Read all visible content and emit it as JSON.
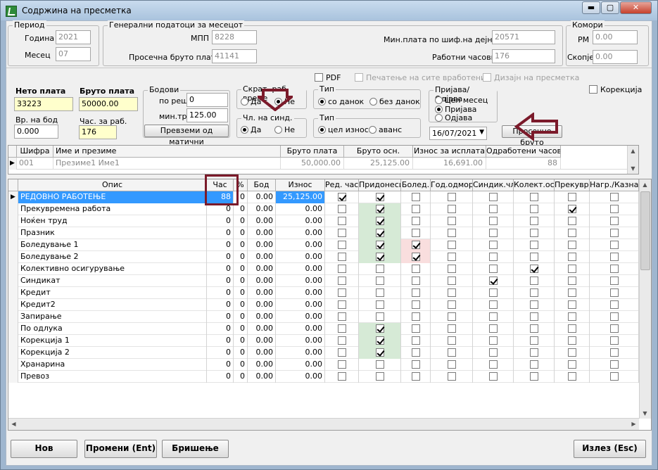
{
  "window": {
    "title": "Содржина на пресметка",
    "min": "▬",
    "max": "▢",
    "close": "✕"
  },
  "period": {
    "legend": "Период",
    "year_label": "Година",
    "year": "2021",
    "month_label": "Месец",
    "month": "07"
  },
  "general": {
    "legend": "Генерални податоци за месецот",
    "mpp_label": "МПП",
    "mpp": "8228",
    "avg_label": "Просечна бруто плата",
    "avg": "41141",
    "min_label": "Мин.плата по шиф.на дејност",
    "min": "20571",
    "hours_label": "Работни часови",
    "hours": "176"
  },
  "chambers": {
    "legend": "Комори",
    "rm_label": "РМ",
    "rm": "0.00",
    "sk_label": "Скопје",
    "sk": "0.00"
  },
  "options": {
    "pdf": "PDF",
    "print_all": "Печатење на сите вработени",
    "design": "Дизајн на пресметка",
    "correction": "Корекција"
  },
  "pay": {
    "net_label": "Нето плата",
    "net": "33223",
    "gross_label": "Бруто плата",
    "gross": "50000.00",
    "points_label": "Вр. на бод",
    "points": "0.000",
    "hours_label": "Час. за раб.",
    "hours": "176"
  },
  "bodovi": {
    "legend": "Бодови",
    "po_label": "по реш.",
    "po": "0",
    "min_label": "мин.тр.",
    "min": "125.00",
    "btn": "Превземи од матични"
  },
  "skrat": {
    "legend": "Скрат. раб. време",
    "yes": "Да",
    "no": "Не"
  },
  "synd": {
    "legend": "Чл. на синд.",
    "yes": "Да",
    "no": "Не"
  },
  "tax": {
    "legend": "Тип",
    "opt1": "со данок",
    "opt2": "без данок"
  },
  "amount": {
    "legend": "Тип",
    "opt1": "цел износ",
    "opt2": "аванс"
  },
  "reg": {
    "legend": "Пријава/Одјава",
    "opt1": "Цел месец",
    "opt2": "Пријава",
    "opt3": "Одјава",
    "date": "16/07/2021",
    "avg_btn": "Просечно бруто"
  },
  "emp_grid": {
    "headers": [
      "Шифра",
      "Име и презиме",
      "Бруто плата",
      "Бруто осн.",
      "Износ за исплата",
      "Одработени часови"
    ],
    "row": [
      "001",
      "Презиме1 Име1",
      "50,000.00",
      "25,125.00",
      "16,691.00",
      "88"
    ]
  },
  "grid": {
    "headers": [
      "Опис",
      "Час",
      "%",
      "Бод",
      "Износ",
      "Ред. час",
      "Придонеси",
      "Болед.",
      "Год.одмор",
      "Синдик.чл.",
      "Колект.ос.",
      "Прекувр.",
      "Нагр./Казна"
    ],
    "rows": [
      {
        "name": "РЕДОВНО РАБОТЕЊЕ",
        "h": "88",
        "p": "0",
        "b": "0.00",
        "a": "25,125.00"
      },
      {
        "name": "Прекувремена работа",
        "h": "0",
        "p": "0",
        "b": "0.00",
        "a": "0.00"
      },
      {
        "name": "Ноќен труд",
        "h": "0",
        "p": "0",
        "b": "0.00",
        "a": "0.00"
      },
      {
        "name": "Празник",
        "h": "0",
        "p": "0",
        "b": "0.00",
        "a": "0.00"
      },
      {
        "name": "Боледување 1",
        "h": "0",
        "p": "0",
        "b": "0.00",
        "a": "0.00"
      },
      {
        "name": "Боледување 2",
        "h": "0",
        "p": "0",
        "b": "0.00",
        "a": "0.00"
      },
      {
        "name": "Колективно осигурување",
        "h": "0",
        "p": "0",
        "b": "0.00",
        "a": "0.00"
      },
      {
        "name": "Синдикат",
        "h": "0",
        "p": "0",
        "b": "0.00",
        "a": "0.00"
      },
      {
        "name": "Кредит",
        "h": "0",
        "p": "0",
        "b": "0.00",
        "a": "0.00"
      },
      {
        "name": "Кредит2",
        "h": "0",
        "p": "0",
        "b": "0.00",
        "a": "0.00"
      },
      {
        "name": "Запирање",
        "h": "0",
        "p": "0",
        "b": "0.00",
        "a": "0.00"
      },
      {
        "name": "По одлука",
        "h": "0",
        "p": "0",
        "b": "0.00",
        "a": "0.00"
      },
      {
        "name": "Корекција 1",
        "h": "0",
        "p": "0",
        "b": "0.00",
        "a": "0.00"
      },
      {
        "name": "Корекција 2",
        "h": "0",
        "p": "0",
        "b": "0.00",
        "a": "0.00"
      },
      {
        "name": "Хранарина",
        "h": "0",
        "p": "0",
        "b": "0.00",
        "a": "0.00"
      },
      {
        "name": "Превоз",
        "h": "0",
        "p": "0",
        "b": "0.00",
        "a": "0.00"
      }
    ]
  },
  "buttons": {
    "new": "Нов",
    "edit": "Промени (Ent)",
    "delete": "Бришење",
    "exit": "Излез (Esc)"
  }
}
